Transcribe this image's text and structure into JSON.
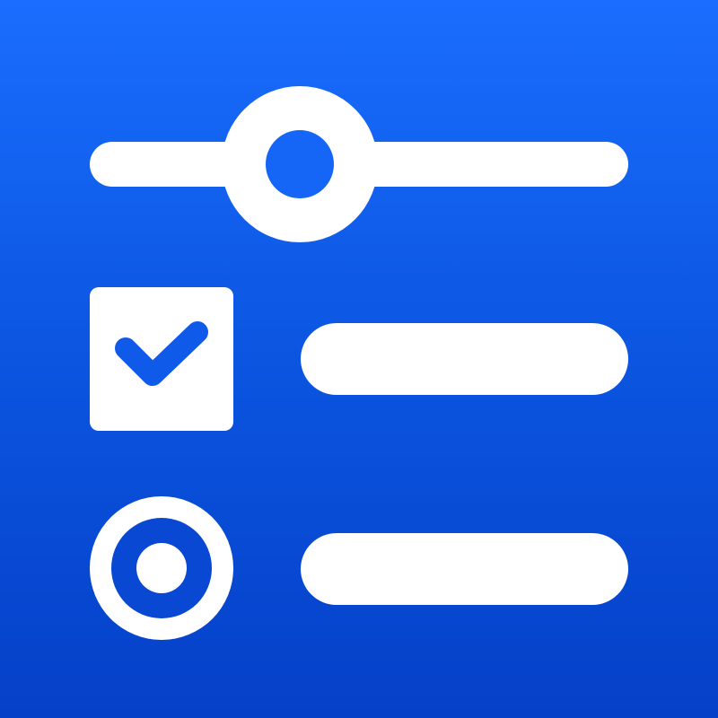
{
  "icon": {
    "name": "form-controls-app-icon",
    "background_gradient": [
      "#1a6dfe",
      "#0b55e0",
      "#0540c8"
    ],
    "foreground_color": "#ffffff",
    "controls": {
      "slider": {
        "level": 0.38
      },
      "checkbox": {
        "checked": true
      },
      "radio": {
        "selected": true
      }
    }
  }
}
